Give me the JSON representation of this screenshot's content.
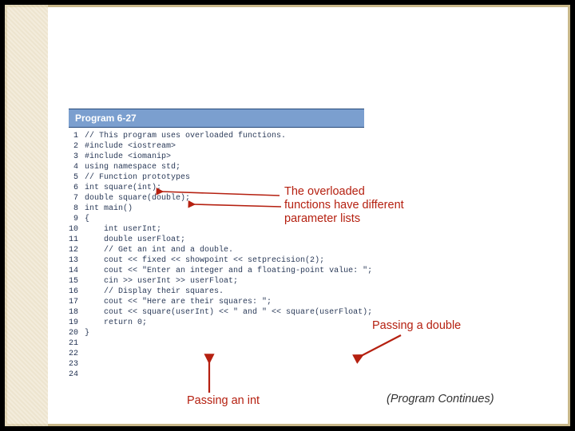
{
  "header": {
    "title": "Program 6-27"
  },
  "code": {
    "lines": [
      "// This program uses overloaded functions.",
      "#include <iostream>",
      "#include <iomanip>",
      "using namespace std;",
      "",
      "// Function prototypes",
      "int square(int);",
      "double square(double);",
      "",
      "int main()",
      "{",
      "    int userInt;",
      "    double userFloat;",
      "",
      "    // Get an int and a double.",
      "    cout << fixed << showpoint << setprecision(2);",
      "    cout << \"Enter an integer and a floating-point value: \";",
      "    cin >> userInt >> userFloat;",
      "",
      "    // Display their squares.",
      "    cout << \"Here are their squares: \";",
      "    cout << square(userInt) << \" and \" << square(userFloat);",
      "    return 0;",
      "}"
    ]
  },
  "annotations": {
    "overloaded": "The overloaded functions have different parameter lists",
    "passing_double": "Passing a double",
    "passing_int": "Passing an int",
    "continues": "(Program Continues)"
  }
}
